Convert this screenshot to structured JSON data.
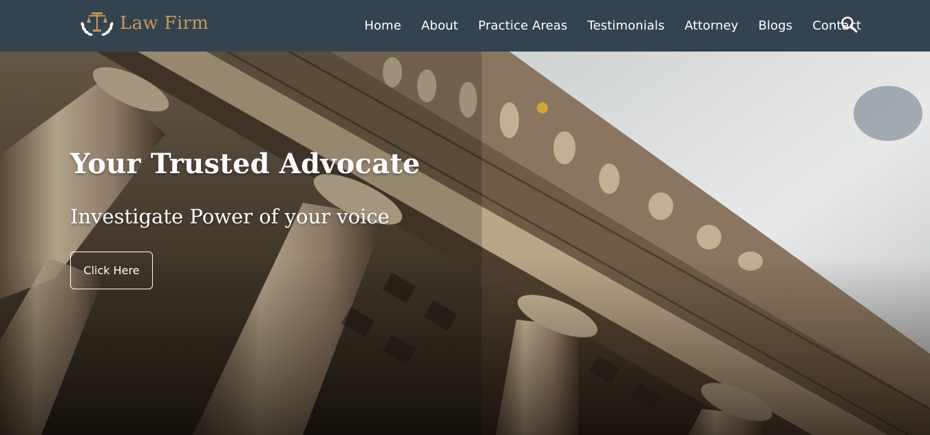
{
  "brand": {
    "name": "Law Firm",
    "logo_icon": "scales-of-justice-with-laurel-icon",
    "color": "#c49a5c"
  },
  "nav": {
    "items": [
      {
        "label": "Home"
      },
      {
        "label": "About"
      },
      {
        "label": "Practice Areas"
      },
      {
        "label": "Testimonials"
      },
      {
        "label": "Attorney"
      },
      {
        "label": "Blogs"
      },
      {
        "label": "Contact"
      }
    ],
    "search_icon": "search-icon",
    "background": "#344350"
  },
  "hero": {
    "background_image": "courthouse-columns-photo",
    "title": "Your Trusted Advocate",
    "subtitle": "Investigate Power of your voice",
    "cta_label": "Click Here"
  }
}
